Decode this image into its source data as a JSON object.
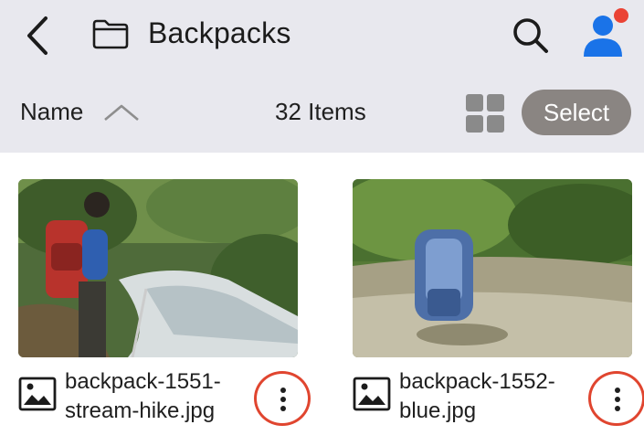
{
  "header": {
    "title": "Backpacks",
    "back_icon": "chevron-left-icon",
    "folder_icon": "folder-icon",
    "search_icon": "search-icon",
    "account_icon": "account-icon",
    "notification_color": "#ea4335",
    "avatar_color": "#1a73e8"
  },
  "toolbar": {
    "sort_label": "Name",
    "sort_direction": "ascending",
    "item_count": "32 Items",
    "view_icon": "grid-view-icon",
    "select_label": "Select"
  },
  "files": [
    {
      "name": "backpack-1551-stream-hike.jpg",
      "line1": "backpack-1551-",
      "line2": "stream-hike.jpg",
      "type_icon": "image-file-icon"
    },
    {
      "name": "backpack-1552-blue.jpg",
      "line1": "backpack-1552-",
      "line2": "blue.jpg",
      "type_icon": "image-file-icon"
    }
  ],
  "colors": {
    "topbar_bg": "#e8e8ee",
    "select_bg": "#8a8582",
    "highlight_ring": "#e0452f"
  }
}
